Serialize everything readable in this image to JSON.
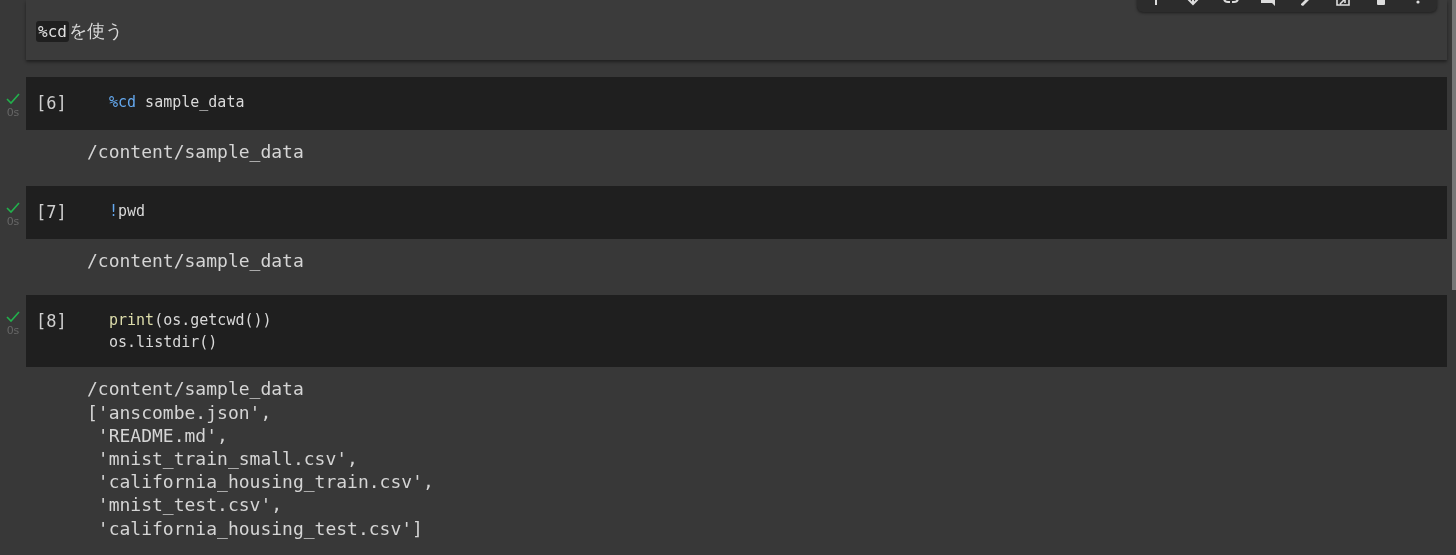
{
  "text_cell": {
    "code": "%cd",
    "text": "を使う"
  },
  "cells": [
    {
      "count": "[6]",
      "done": true,
      "time": "0s",
      "lines": [
        [
          {
            "t": "%cd",
            "kind": "magic"
          },
          {
            "t": " sample_data",
            "kind": "plain"
          }
        ]
      ],
      "output": [
        "/content/sample_data"
      ]
    },
    {
      "count": "[7]",
      "done": true,
      "time": "0s",
      "lines": [
        [
          {
            "t": "!",
            "kind": "magic"
          },
          {
            "t": "pwd",
            "kind": "plain"
          }
        ]
      ],
      "output": [
        "/content/sample_data"
      ]
    },
    {
      "count": "[8]",
      "done": true,
      "time": "0s",
      "lines": [
        [
          {
            "t": "print",
            "kind": "builtin"
          },
          {
            "t": "(os.getcwd())",
            "kind": "plain"
          }
        ],
        [
          {
            "t": "os.listdir()",
            "kind": "plain"
          }
        ]
      ],
      "output": [
        "/content/sample_data",
        "['anscombe.json',",
        " 'README.md',",
        " 'mnist_train_small.csv',",
        " 'california_housing_train.csv',",
        " 'mnist_test.csv',",
        " 'california_housing_test.csv']"
      ]
    }
  ]
}
